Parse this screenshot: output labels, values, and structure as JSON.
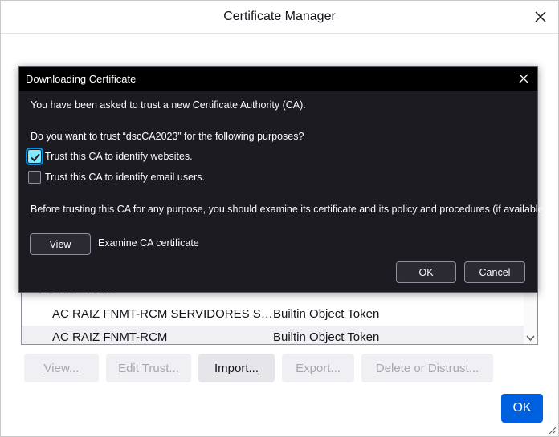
{
  "cert_manager": {
    "title": "Certificate Manager",
    "tree_header": "AC RAIZ FNMT",
    "rows": [
      {
        "name": "AC RAIZ FNMT-RCM SERVIDORES SEG...",
        "device": "Builtin Object Token"
      },
      {
        "name": "AC RAIZ FNMT-RCM",
        "device": "Builtin Object Token"
      }
    ],
    "buttons": {
      "view": "View...",
      "edit_trust": "Edit Trust...",
      "import": "Import...",
      "export": "Export...",
      "delete": "Delete or Distrust..."
    },
    "ok_label": "OK"
  },
  "dialog": {
    "title": "Downloading Certificate",
    "intro": "You have been asked to trust a new Certificate Authority (CA).",
    "question": "Do you want to trust “dscCA2023” for the following purposes?",
    "checkbox_websites": {
      "label": "Trust this CA to identify websites.",
      "checked": true
    },
    "checkbox_email": {
      "label": "Trust this CA to identify email users.",
      "checked": false
    },
    "advice": "Before trusting this CA for any purpose, you should examine its certificate and its policy and procedures (if available).",
    "view_label": "View",
    "examine_label": "Examine CA certificate",
    "ok_label": "OK",
    "cancel_label": "Cancel"
  },
  "colors": {
    "dialog_bg": "#1c1b22",
    "titlebar_bg": "#000000",
    "accent": "#0061e0",
    "checkbox_checked": "#80ebff"
  }
}
